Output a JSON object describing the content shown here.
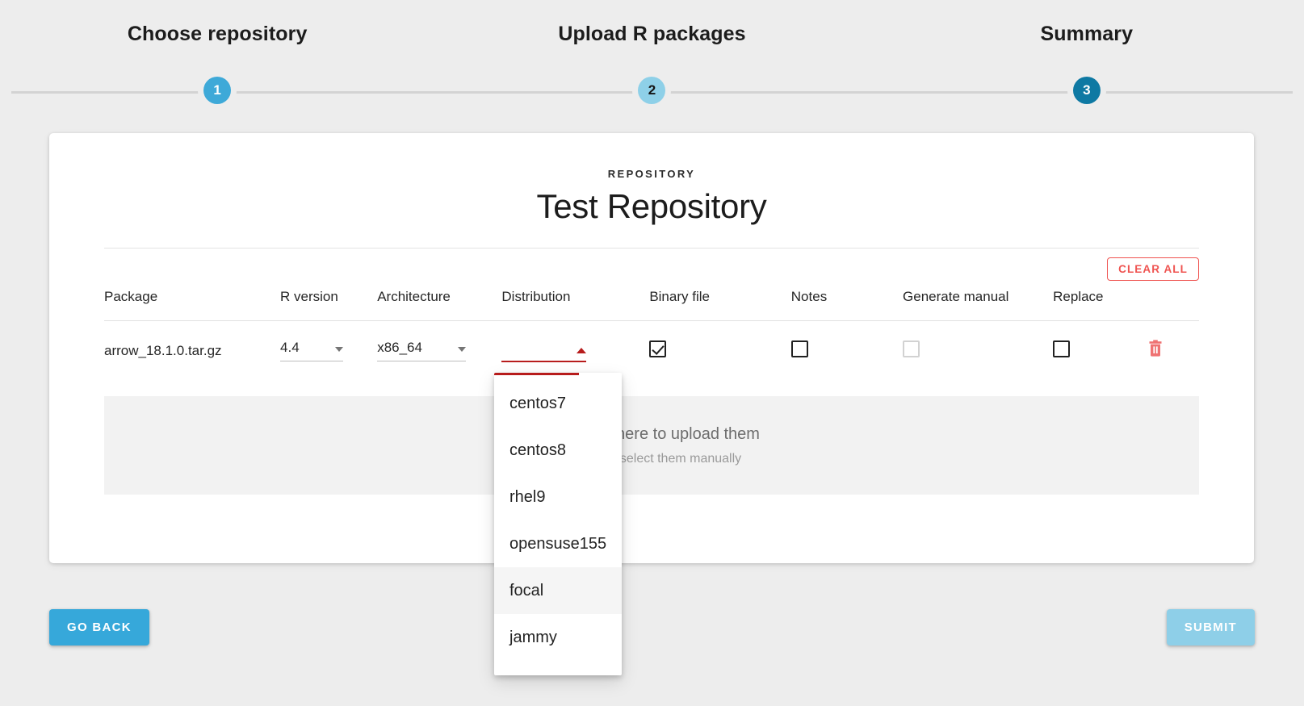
{
  "stepper": {
    "steps": [
      {
        "number": "1",
        "label": "Choose repository",
        "state": "done"
      },
      {
        "number": "2",
        "label": "Upload R packages",
        "state": "active"
      },
      {
        "number": "3",
        "label": "Summary",
        "state": "todo"
      }
    ]
  },
  "card": {
    "eyebrow": "REPOSITORY",
    "title": "Test Repository",
    "clear_all_label": "CLEAR ALL"
  },
  "table": {
    "headers": {
      "package": "Package",
      "r_version": "R version",
      "architecture": "Architecture",
      "distribution": "Distribution",
      "binary_file": "Binary file",
      "notes": "Notes",
      "generate_manual": "Generate manual",
      "replace": "Replace"
    },
    "rows": [
      {
        "package": "arrow_18.1.0.tar.gz",
        "r_version": "4.4",
        "architecture": "x86_64",
        "distribution": "",
        "binary_file_checked": true,
        "notes_checked": false,
        "generate_manual_checked": false,
        "generate_manual_disabled": true,
        "replace_checked": false,
        "delete_icon": "trash-icon"
      }
    ]
  },
  "distribution_menu": {
    "open": true,
    "options": [
      "centos7",
      "centos8",
      "rhel9",
      "opensuse155",
      "focal",
      "jammy"
    ],
    "hovered": "focal"
  },
  "dropzone": {
    "line1": "Drop files here to upload them",
    "line2": "or click to select them manually"
  },
  "footer": {
    "back_label": "GO BACK",
    "submit_label": "SUBMIT"
  },
  "colors": {
    "step_done": "#3ea9d8",
    "step_active": "#8ed0e8",
    "step_todo": "#0e79a3",
    "danger": "#ef5350",
    "error_underline": "#b71c1c",
    "primary": "#36a8da",
    "primary_disabled": "#8ecfe8"
  }
}
